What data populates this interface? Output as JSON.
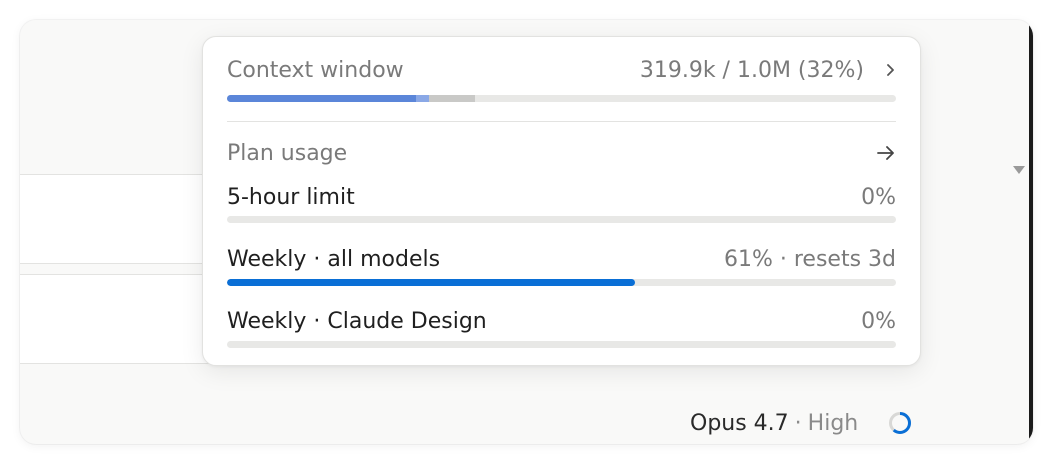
{
  "context": {
    "title": "Context window",
    "value": "319.9k / 1.0M (32%)",
    "segments": [
      {
        "fraction": 0.2825,
        "color": "#5b86d9"
      },
      {
        "fraction": 0.0195,
        "color": "#8aa8e6"
      },
      {
        "fraction": 0.068,
        "color": "#c9c9c7"
      }
    ]
  },
  "plan": {
    "title": "Plan usage",
    "limits": [
      {
        "label": "5-hour limit",
        "value": "0%",
        "fraction": 0
      },
      {
        "label": "Weekly · all models",
        "value": "61% · resets 3d",
        "fraction": 0.61
      },
      {
        "label": "Weekly · Claude Design",
        "value": "0%",
        "fraction": 0
      }
    ]
  },
  "model": {
    "name": "Opus 4.7",
    "separator": "·",
    "effort": "High"
  },
  "colors": {
    "accent": "#0a6fd6",
    "track": "#e8e8e6"
  }
}
